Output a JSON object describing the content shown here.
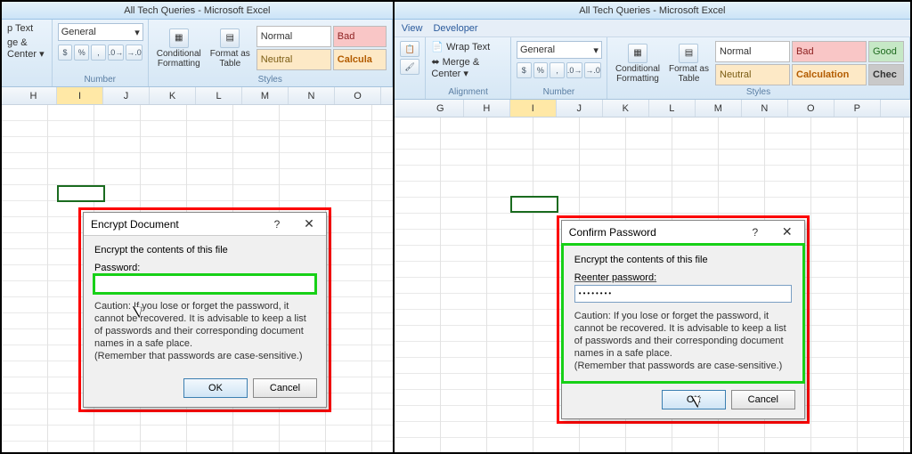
{
  "app_title": "All Tech Queries - Microsoft Excel",
  "menu": {
    "view": "View",
    "developer": "Developer"
  },
  "ribbon": {
    "wrap_text": "p Text",
    "wrap_text_full": "Wrap Text",
    "merge_center": "ge & Center",
    "merge_center_full": "Merge & Center",
    "alignment_group": "Alignment",
    "number_format": "General",
    "number_group": "Number",
    "conditional_formatting": "Conditional\nFormatting",
    "format_as_table": "Format as\nTable",
    "styles": {
      "normal": "Normal",
      "bad": "Bad",
      "neutral": "Neutral",
      "calculation": "Calculation",
      "calc_short": "Calcula",
      "good": "Good",
      "check_short": "Chec"
    },
    "styles_group": "Styles"
  },
  "columns_left": [
    "H",
    "I",
    "J",
    "K",
    "L",
    "M",
    "N",
    "O"
  ],
  "columns_right": [
    "G",
    "H",
    "I",
    "J",
    "K",
    "L",
    "M",
    "N",
    "O",
    "P"
  ],
  "selected_col_left": "I",
  "selected_col_right": "I",
  "dialog_left": {
    "title": "Encrypt Document",
    "subtitle": "Encrypt the contents of this file",
    "password_label": "Password:",
    "password_value": "",
    "caution": "Caution: If you lose or forget the password, it cannot be recovered. It is advisable to keep a list of passwords and their corresponding document names in a safe place.\n(Remember that passwords are case-sensitive.)",
    "ok": "OK",
    "cancel": "Cancel"
  },
  "dialog_right": {
    "title": "Confirm Password",
    "subtitle": "Encrypt the contents of this file",
    "password_label": "Reenter password:",
    "password_value": "••••••••",
    "caution": "Caution: If you lose or forget the password, it cannot be recovered. It is advisable to keep a list of passwords and their corresponding document names in a safe place.\n(Remember that passwords are case-sensitive.)",
    "ok": "OK",
    "cancel": "Cancel"
  },
  "help_symbol": "?",
  "close_symbol": "✕",
  "dropdown_symbol": "▾",
  "currency_symbol": "$",
  "percent_symbol": "%",
  "comma_symbol": ",",
  "dec_inc": ".0→",
  "dec_dec": "→.0"
}
